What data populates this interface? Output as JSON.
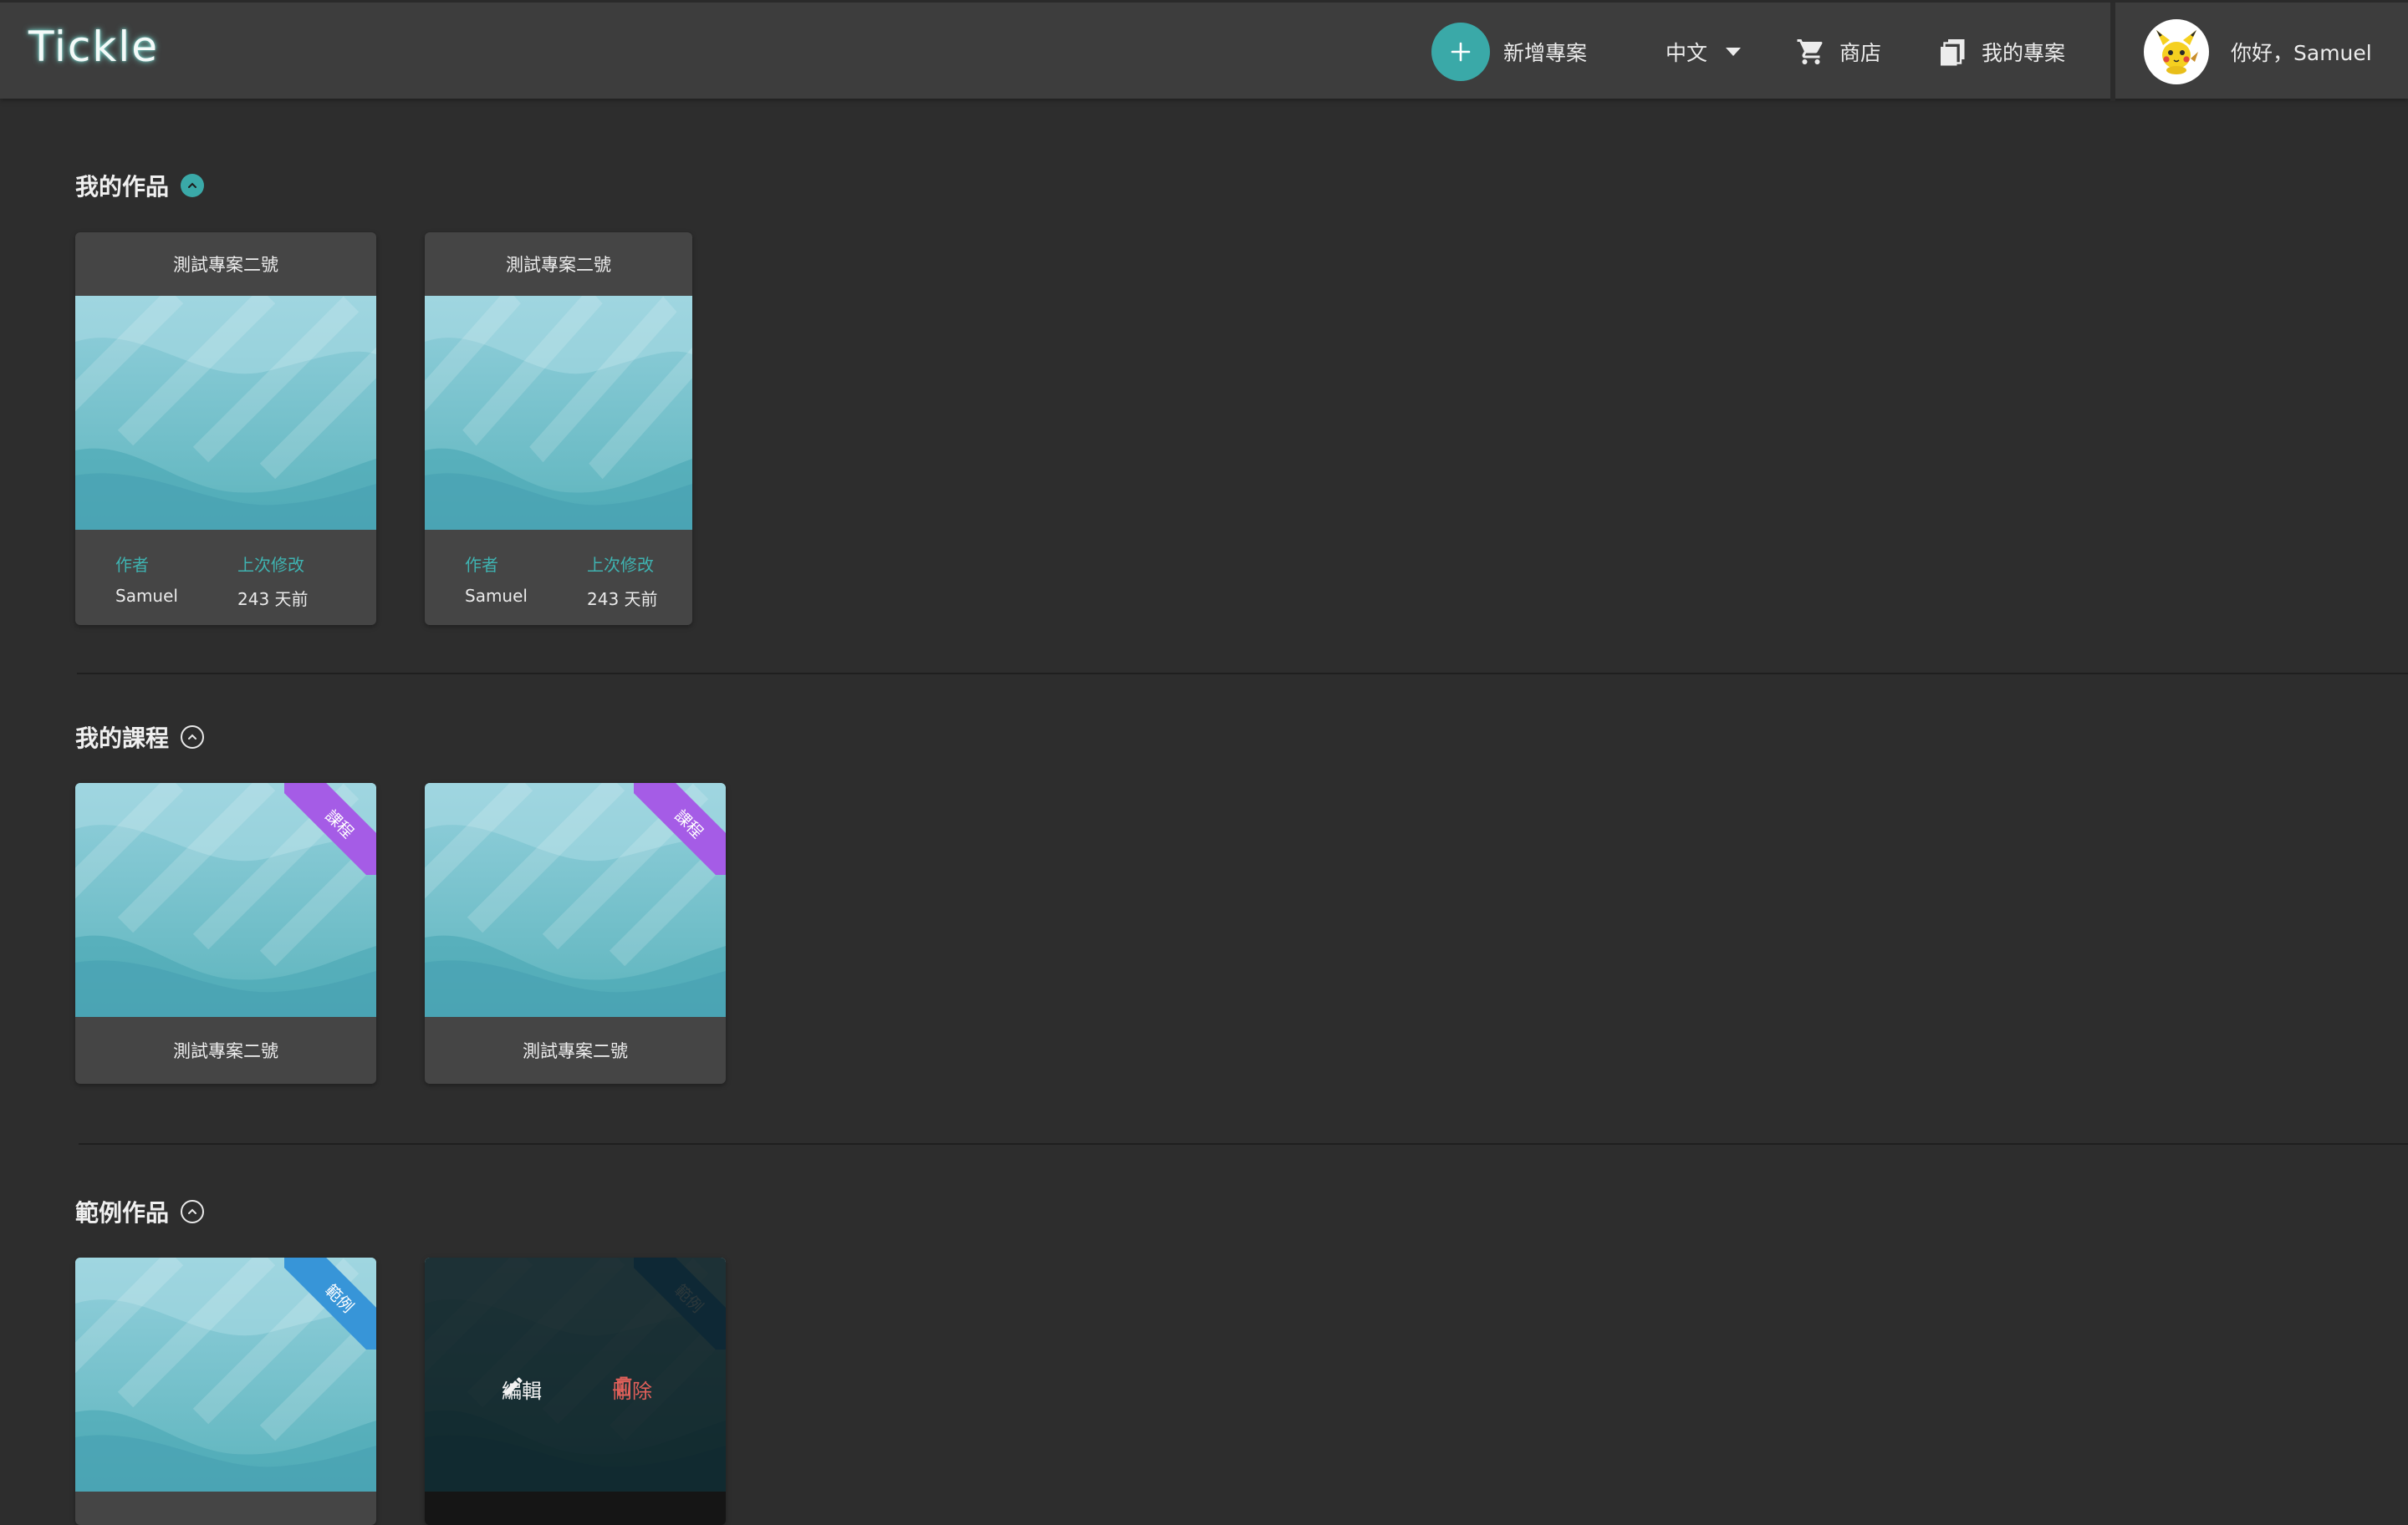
{
  "header": {
    "logo": "Tickle",
    "new_project_label": "新增專案",
    "language_label": "中文",
    "shop_label": "商店",
    "my_projects_label": "我的專案",
    "greeting": "你好，Samuel"
  },
  "sections": {
    "my_works": {
      "title": "我的作品",
      "cards": [
        {
          "title": "測試專案二號",
          "author_label": "作者",
          "author": "Samuel",
          "modified_label": "上次修改",
          "modified": "243 天前"
        },
        {
          "title": "測試專案二號",
          "author_label": "作者",
          "author": "Samuel",
          "modified_label": "上次修改",
          "modified": "243 天前"
        }
      ]
    },
    "my_courses": {
      "title": "我的課程",
      "cards": [
        {
          "title": "測試專案二號",
          "ribbon": "課程"
        },
        {
          "title": "測試專案二號",
          "ribbon": "課程"
        }
      ]
    },
    "examples": {
      "title": "範例作品",
      "cards": [
        {
          "ribbon": "範例"
        },
        {
          "ribbon": "範例",
          "edit_label": "編輯",
          "delete_label": "刪除"
        }
      ]
    }
  },
  "colors": {
    "accent": "#3aa9a8",
    "course_ribbon": "#a55ce6",
    "example_ribbon": "#3795d8",
    "delete": "#e0605a"
  }
}
